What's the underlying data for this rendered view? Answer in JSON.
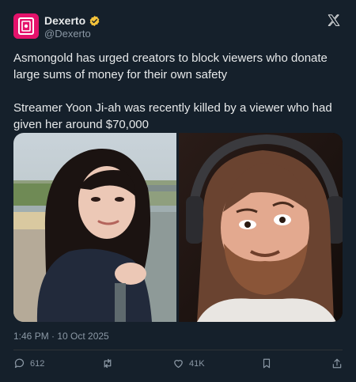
{
  "author": {
    "name": "Dexerto",
    "handle": "@Dexerto",
    "verified": true,
    "avatar_color": "#e4126b"
  },
  "tweet": {
    "paragraph1": "Asmongold has urged creators to block viewers who donate large sums of money for their own safety",
    "paragraph2": "Streamer Yoon Ji-ah was recently killed by a viewer who had given her around $70,000"
  },
  "timestamp": "1:46 PM · 10 Oct 2025",
  "actions": {
    "replies": "612",
    "likes": "41K"
  },
  "colors": {
    "background": "#15202b",
    "text": "#e7e9ea",
    "muted": "#8b98a5",
    "verified_badge": "#f5c33b"
  },
  "icons": [
    "x-logo-icon",
    "verified-badge-icon",
    "reply-icon",
    "retweet-icon",
    "like-icon",
    "bookmark-icon",
    "share-icon"
  ]
}
